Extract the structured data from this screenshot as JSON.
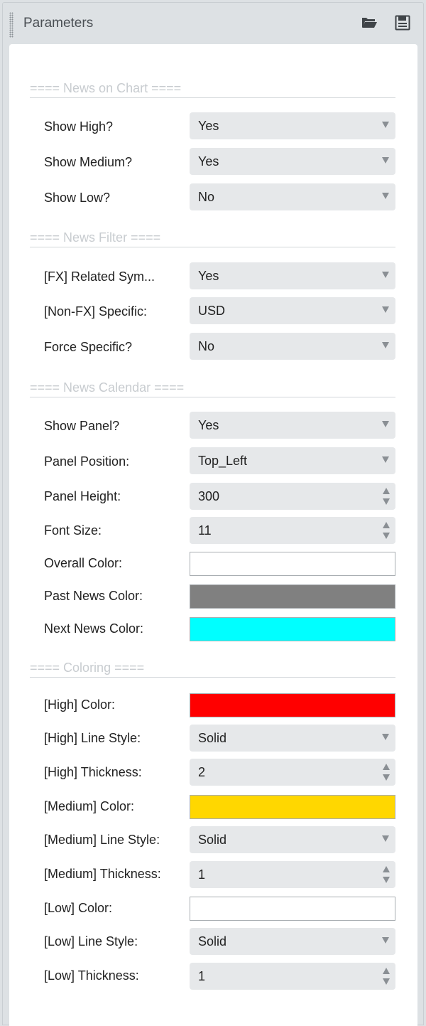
{
  "panel": {
    "title": "Parameters",
    "buttons": {
      "open_icon": "folder-open-icon",
      "save_icon": "floppy-disk-icon"
    }
  },
  "sections": {
    "news_on_chart": "==== News on Chart ====",
    "news_filter": "==== News Filter ====",
    "news_calendar": "==== News Calendar ====",
    "coloring": "==== Coloring ===="
  },
  "params": {
    "show_high": {
      "label": "Show High?",
      "value": "Yes"
    },
    "show_medium": {
      "label": "Show Medium?",
      "value": "Yes"
    },
    "show_low": {
      "label": "Show Low?",
      "value": "No"
    },
    "fx_related": {
      "label": "[FX] Related Sym...",
      "value": "Yes"
    },
    "nonfx_specific": {
      "label": "[Non-FX] Specific:",
      "value": "USD"
    },
    "force_specific": {
      "label": "Force Specific?",
      "value": "No"
    },
    "show_panel": {
      "label": "Show Panel?",
      "value": "Yes"
    },
    "panel_position": {
      "label": "Panel Position:",
      "value": "Top_Left"
    },
    "panel_height": {
      "label": "Panel Height:",
      "value": "300"
    },
    "font_size": {
      "label": "Font Size:",
      "value": "11"
    },
    "overall_color": {
      "label": "Overall Color:",
      "color": "#ffffff"
    },
    "past_news_color": {
      "label": "Past News Color:",
      "color": "#808080"
    },
    "next_news_color": {
      "label": "Next News Color:",
      "color": "#00ffff"
    },
    "high_color": {
      "label": "[High] Color:",
      "color": "#ff0000"
    },
    "high_line_style": {
      "label": "[High] Line Style:",
      "value": "Solid"
    },
    "high_thickness": {
      "label": "[High] Thickness:",
      "value": "2"
    },
    "medium_color": {
      "label": "[Medium] Color:",
      "color": "#ffd700"
    },
    "medium_line_style": {
      "label": "[Medium] Line Style:",
      "value": "Solid"
    },
    "medium_thickness": {
      "label": "[Medium] Thickness:",
      "value": "1"
    },
    "low_color": {
      "label": "[Low] Color:",
      "color": "#ffffff"
    },
    "low_line_style": {
      "label": "[Low] Line Style:",
      "value": "Solid"
    },
    "low_thickness": {
      "label": "[Low] Thickness:",
      "value": "1"
    }
  }
}
